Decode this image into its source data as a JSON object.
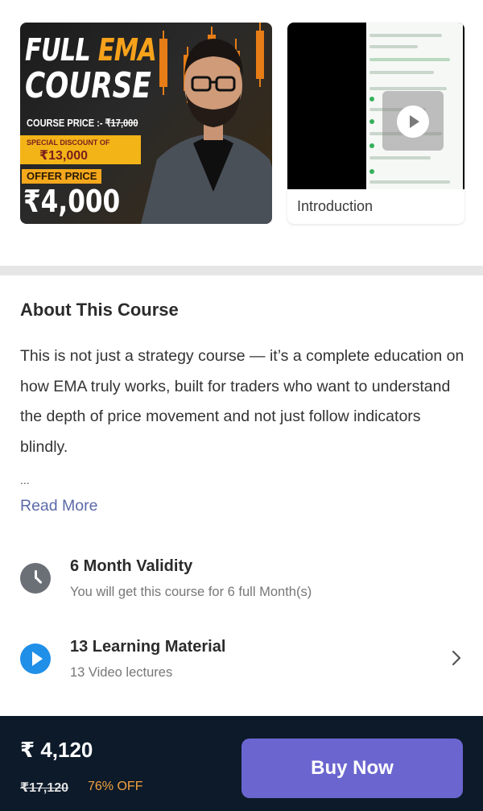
{
  "carousel": {
    "thumb_main": {
      "title_full": "FULL",
      "title_ema": "EMA",
      "title_course": "COURSE",
      "course_price_label": "COURSE PRICE :-",
      "course_price_value": "₹17,000",
      "special_discount_label": "SPECIAL DISCOUNT OF",
      "special_discount_value": "₹13,000",
      "offer_price_label": "OFFER PRICE",
      "offer_price_value": "₹4,000"
    },
    "video": {
      "caption": "Introduction"
    }
  },
  "about": {
    "title": "About This Course",
    "description": "This is not just a strategy course — it’s a complete education on how EMA truly works, built for traders who want to understand the depth of price movement and not just follow indicators blindly.",
    "ellipsis": "...",
    "read_more": "Read More"
  },
  "features": [
    {
      "icon": "clock-icon",
      "title": "6 Month Validity",
      "subtitle": "You will get this course for 6 full Month(s)"
    },
    {
      "icon": "play-circle-icon",
      "title": "13 Learning Material",
      "subtitle": "13 Video lectures"
    }
  ],
  "footer": {
    "price": "₹ 4,120",
    "original_price": "₹17,120",
    "discount": "76% OFF",
    "buy_label": "Buy Now"
  },
  "colors": {
    "accent": "#6b66cf",
    "footer_bg": "#0c1a2a",
    "discount": "#f4a23c",
    "link": "#5b6aa8",
    "play_icon": "#1f8fe8"
  }
}
